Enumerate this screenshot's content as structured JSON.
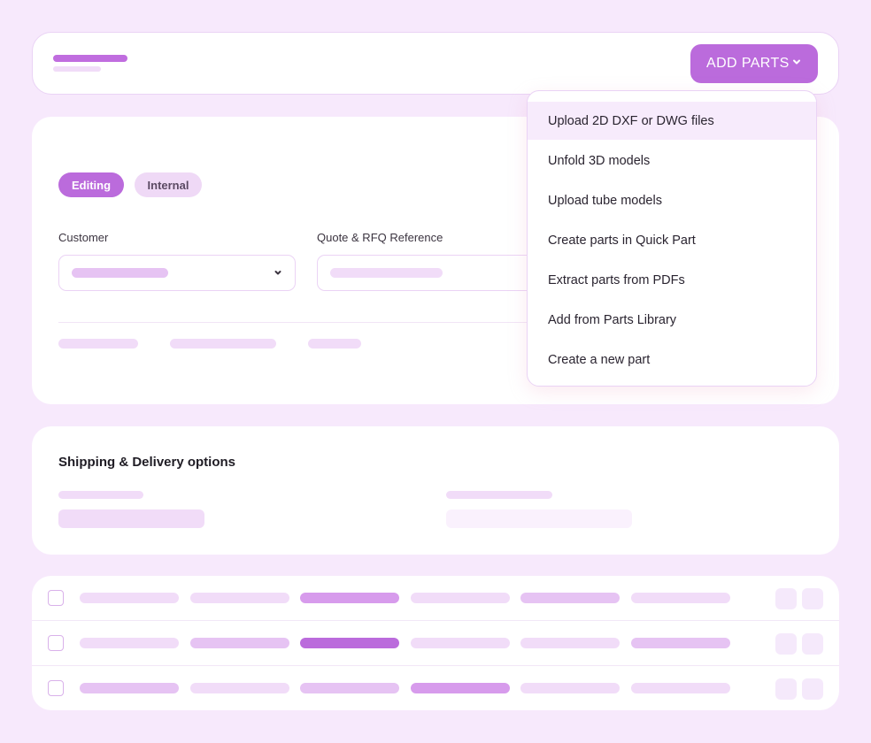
{
  "header": {
    "add_parts_label": "ADD PARTS"
  },
  "status_chips": {
    "editing": "Editing",
    "internal": "Internal"
  },
  "form": {
    "customer_label": "Customer",
    "quote_reference_label": "Quote & RFQ Reference"
  },
  "add_parts_menu": {
    "items": [
      "Upload 2D DXF or DWG files",
      "Unfold 3D models",
      "Upload tube models",
      "Create parts in Quick Part",
      "Extract parts from PDFs",
      "Add from Parts Library",
      "Create a new part"
    ]
  },
  "shipping": {
    "title": "Shipping & Delivery options"
  },
  "colors": {
    "accent": "#bb6bdc",
    "page_background": "#f7e9fc",
    "placeholder_light": "#f1dcf8",
    "placeholder_medium": "#e6c3f3",
    "placeholder_strong": "#d79bec"
  },
  "icons": {
    "dropdown": "chevron-down-icon"
  }
}
